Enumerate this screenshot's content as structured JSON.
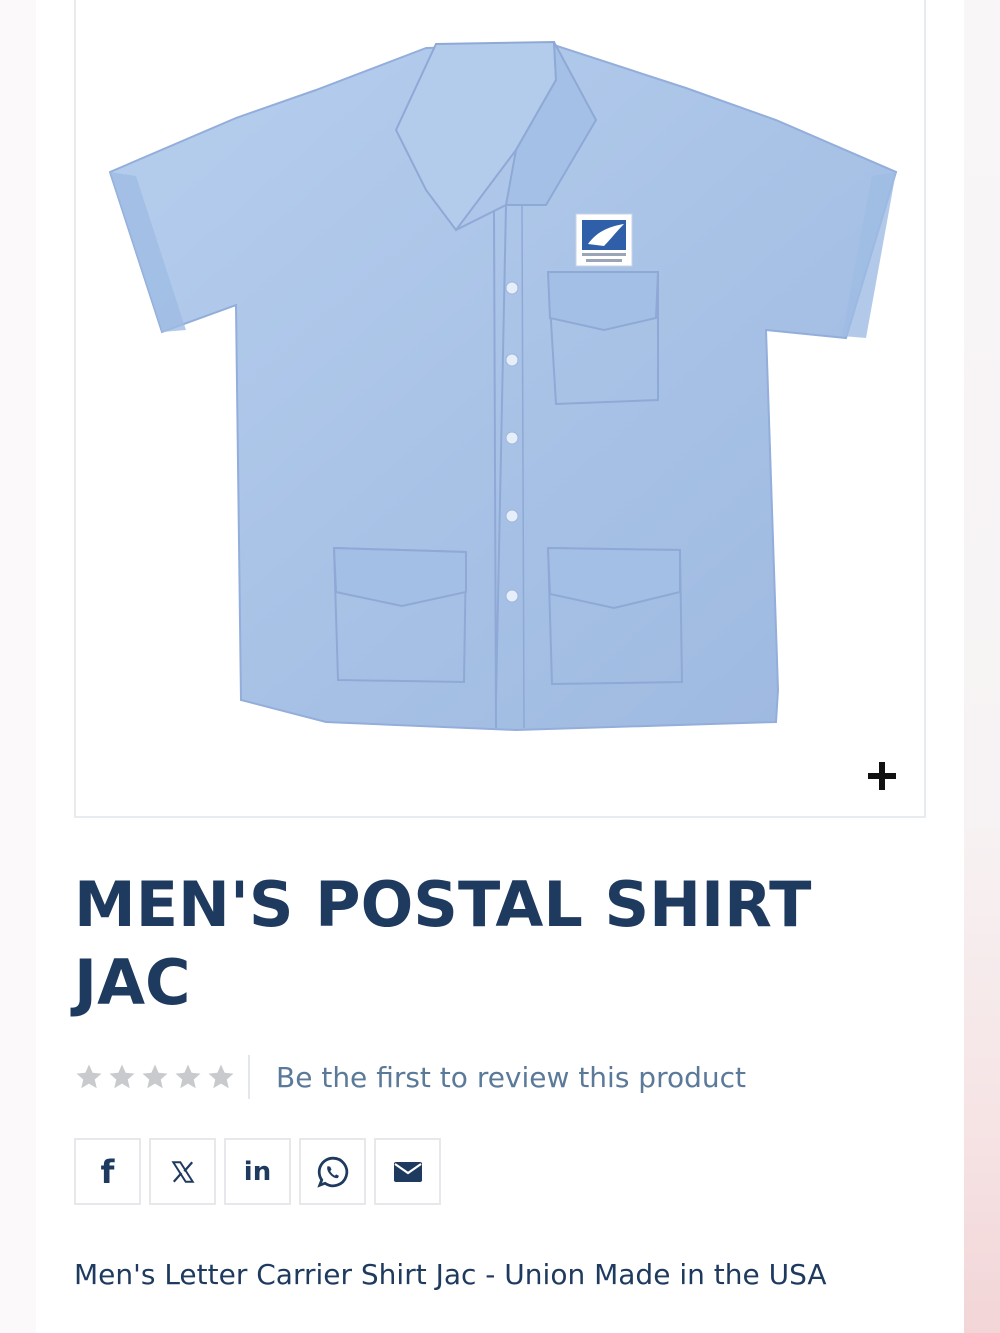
{
  "product": {
    "title": "MEN'S POSTAL SHIRT JAC",
    "description": "Men's Letter Carrier Shirt Jac - Union Made in the USA",
    "image_alt": "Men's postal shirt jac, light blue short-sleeve shirt with USPS eagle patch"
  },
  "gallery": {
    "zoom_icon": "plus-icon"
  },
  "rating": {
    "stars_filled": 0,
    "stars_total": 5,
    "review_link": "Be the first to review this product"
  },
  "share": {
    "buttons": [
      {
        "network": "facebook",
        "icon": "facebook-icon",
        "glyph": "f"
      },
      {
        "network": "x",
        "icon": "x-icon",
        "glyph": "𝕏"
      },
      {
        "network": "linkedin",
        "icon": "linkedin-icon",
        "glyph": "in"
      },
      {
        "network": "whatsapp",
        "icon": "whatsapp-icon"
      },
      {
        "network": "email",
        "icon": "envelope-icon"
      }
    ]
  },
  "colors": {
    "title": "#1e3a5f",
    "link": "#5b7a99",
    "star_empty": "#c8cacd",
    "shirt": "#aac4e8",
    "border": "#e9ecef"
  }
}
